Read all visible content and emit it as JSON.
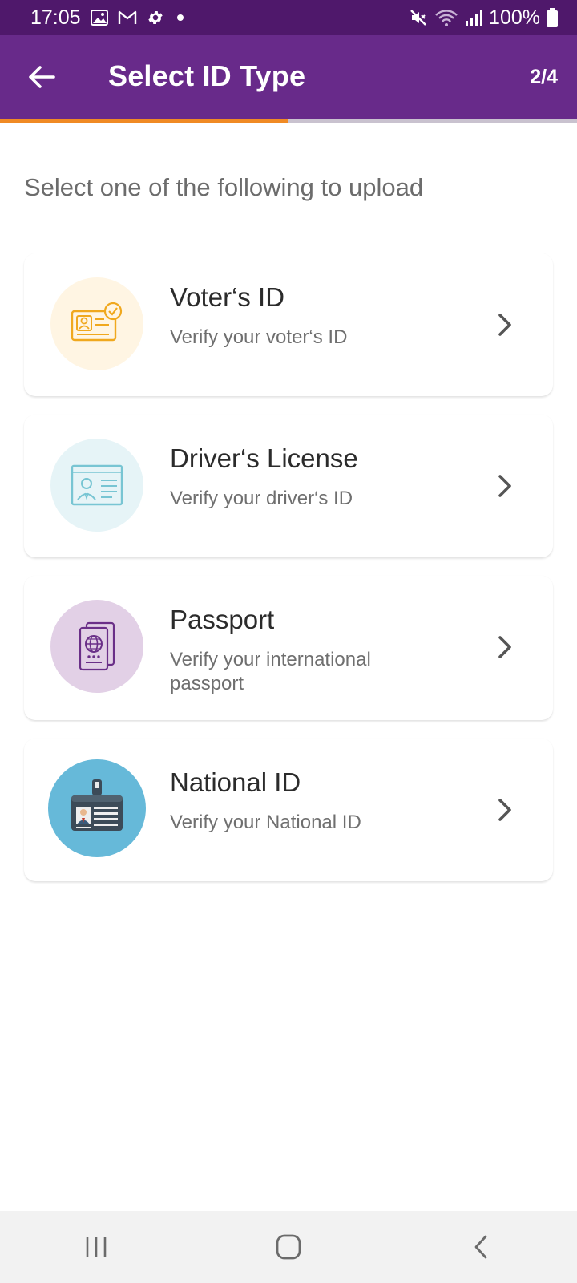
{
  "status_bar": {
    "time": "17:05",
    "battery": "100%",
    "icons": [
      "image-icon",
      "gmail-icon",
      "settings-icon",
      "dot-icon",
      "mute-icon",
      "wifi-icon",
      "signal-icon",
      "battery-icon"
    ]
  },
  "header": {
    "title": "Select ID Type",
    "step": "2/4",
    "back_icon": "arrow-left-icon",
    "progress_fraction": 0.5
  },
  "main": {
    "instruction": "Select one of the following to upload",
    "options": [
      {
        "title": "Voter‘s ID",
        "subtitle": "Verify your voter‘s ID",
        "icon": "voter-card-icon",
        "circle_color": "#fff5e3"
      },
      {
        "title": "Driver‘s License",
        "subtitle": "Verify your driver‘s ID",
        "icon": "license-card-icon",
        "circle_color": "#e6f4f7"
      },
      {
        "title": "Passport",
        "subtitle": "Verify your international passport",
        "icon": "passport-icon",
        "circle_color": "#e2d0e6"
      },
      {
        "title": "National ID",
        "subtitle": "Verify your National ID",
        "icon": "id-badge-icon",
        "circle_color": "#66b9d9"
      }
    ]
  },
  "nav_bar": {
    "icons": [
      "recent-apps-icon",
      "home-icon",
      "back-icon"
    ]
  },
  "colors": {
    "status_bar": "#4f186b",
    "app_bar": "#682a8a",
    "progress": "#f08a24",
    "progress_track": "#c9c2cf"
  }
}
